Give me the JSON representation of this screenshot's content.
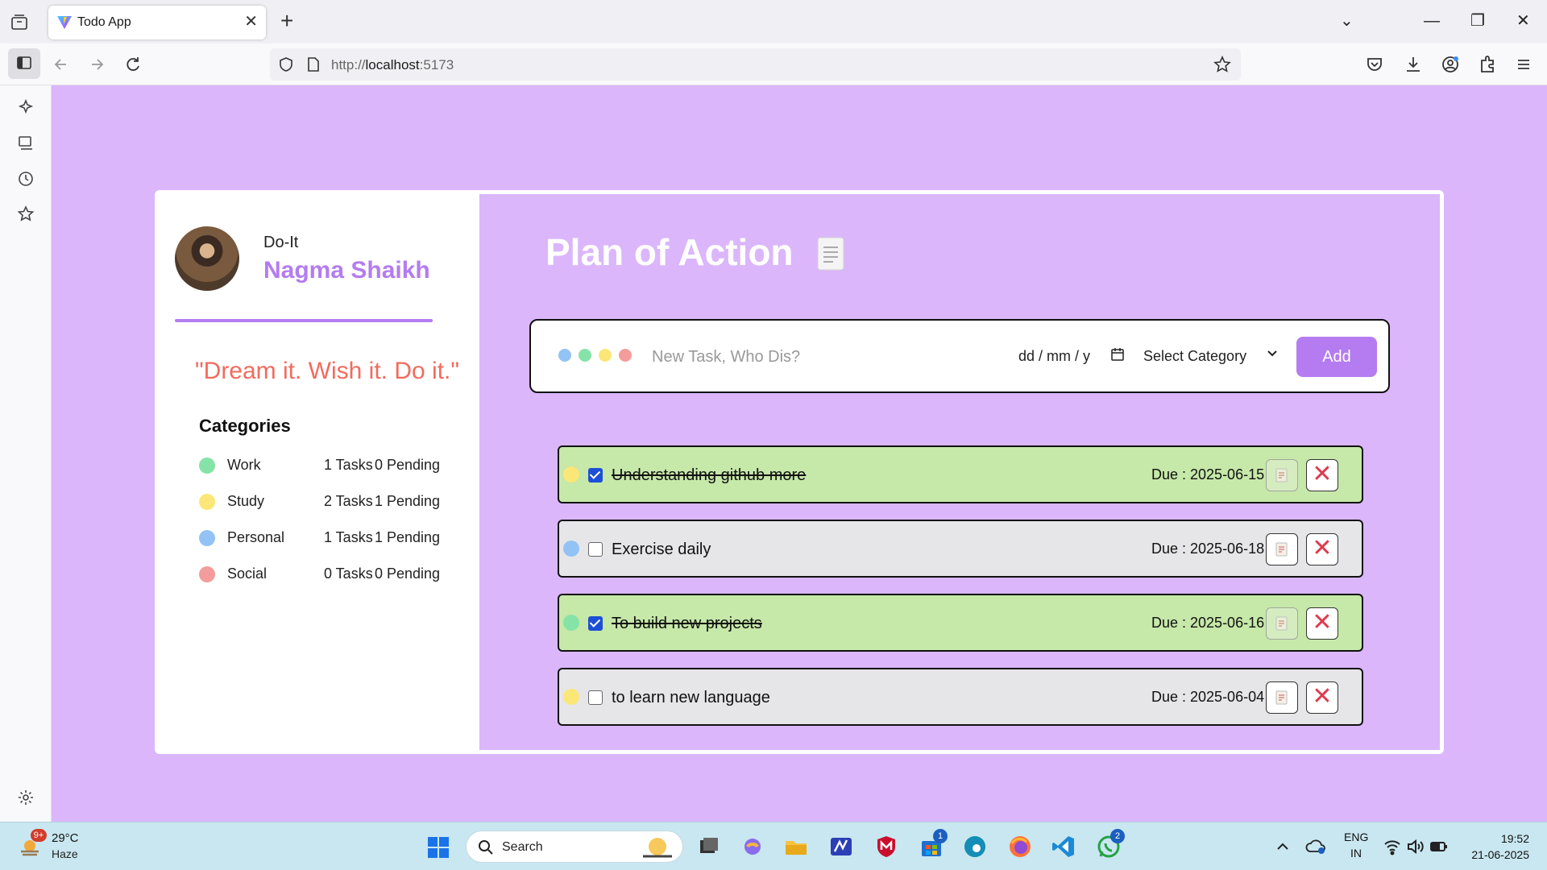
{
  "browser": {
    "tab_title": "Todo App",
    "tab_close": "✕",
    "new_tab": "+",
    "url_prefix": "http://",
    "url_host": "localhost",
    "url_port": ":5173",
    "window_controls": {
      "dropdown": "⌄",
      "minimize": "—",
      "restore": "❐",
      "close": "✕"
    }
  },
  "profile": {
    "brand": "Do-It",
    "name": "Nagma Shaikh",
    "quote": "\"Dream it. Wish it. Do it.\""
  },
  "categories": {
    "heading": "Categories",
    "items": [
      {
        "name": "Work",
        "tasks": "1 Tasks",
        "pending": "0 Pending",
        "color": "#86e3a8"
      },
      {
        "name": "Study",
        "tasks": "2 Tasks",
        "pending": "1 Pending",
        "color": "#fbe778"
      },
      {
        "name": "Personal",
        "tasks": "1 Tasks",
        "pending": "1 Pending",
        "color": "#93c3f5"
      },
      {
        "name": "Social",
        "tasks": "0 Tasks",
        "pending": "0 Pending",
        "color": "#f49c9c"
      }
    ]
  },
  "main": {
    "title": "Plan of Action",
    "add_form": {
      "placeholder": "New Task, Who Dis?",
      "date_placeholder": "dd / mm / y",
      "category_select": "Select Category",
      "add_label": "Add",
      "dot_colors": [
        "#93c3f5",
        "#86e3a8",
        "#fbe778",
        "#f49c9c"
      ]
    },
    "tasks": [
      {
        "title": "Understanding github more ",
        "due": "Due : 2025-06-15",
        "done": true,
        "color": "#fbe778"
      },
      {
        "title": "Exercise daily",
        "due": "Due : 2025-06-18",
        "done": false,
        "color": "#93c3f5"
      },
      {
        "title": "To build new projects",
        "due": "Due : 2025-06-16",
        "done": true,
        "color": "#86e3a8"
      },
      {
        "title": "to learn new language",
        "due": "Due : 2025-06-04",
        "done": false,
        "color": "#fbe778"
      }
    ],
    "delete_glyph": "✕"
  },
  "taskbar": {
    "weather_temp": "29°C",
    "weather_desc": "Haze",
    "weather_badge": "9+",
    "search_label": "Search",
    "store_badge": "1",
    "whatsapp_badge": "2",
    "language_top": "ENG",
    "language_bottom": "IN",
    "time": "19:52",
    "date": "21-06-2025"
  }
}
